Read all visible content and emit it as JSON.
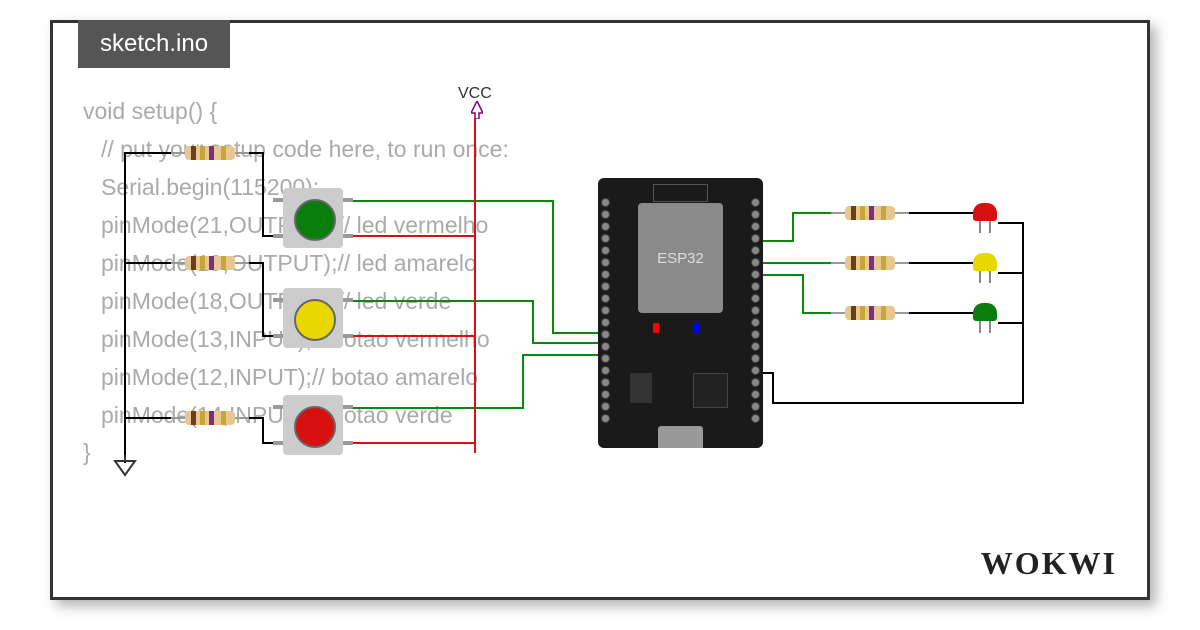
{
  "tab": {
    "filename": "sketch.ino"
  },
  "code": {
    "line1": "void setup() {",
    "line2": "// put your setup code here, to run once:",
    "line3": "Serial.begin(115200);",
    "line4": "pinMode(21,OUTPUT);// led vermelho",
    "line5": "pinMode(19,OUTPUT);// led amarelo",
    "line6": "pinMode(18,OUTPUT);// led verde",
    "line7": "pinMode(13,INPUT);// botao vermelho",
    "line8": "pinMode(12,INPUT);// botao amarelo",
    "line9": "pinMode(14,INPUT);// botao verde",
    "line10": "}"
  },
  "labels": {
    "vcc": "VCC",
    "board": "ESP32"
  },
  "logo": "WOKWI",
  "components": {
    "board": "ESP32 DevKit",
    "buttons": [
      {
        "color": "green",
        "pin": 14
      },
      {
        "color": "yellow",
        "pin": 12
      },
      {
        "color": "red",
        "pin": 13
      }
    ],
    "leds": [
      {
        "color": "red",
        "pin": 21
      },
      {
        "color": "yellow",
        "pin": 19
      },
      {
        "color": "green",
        "pin": 18
      }
    ],
    "resistors_button": 3,
    "resistors_led": 3
  }
}
